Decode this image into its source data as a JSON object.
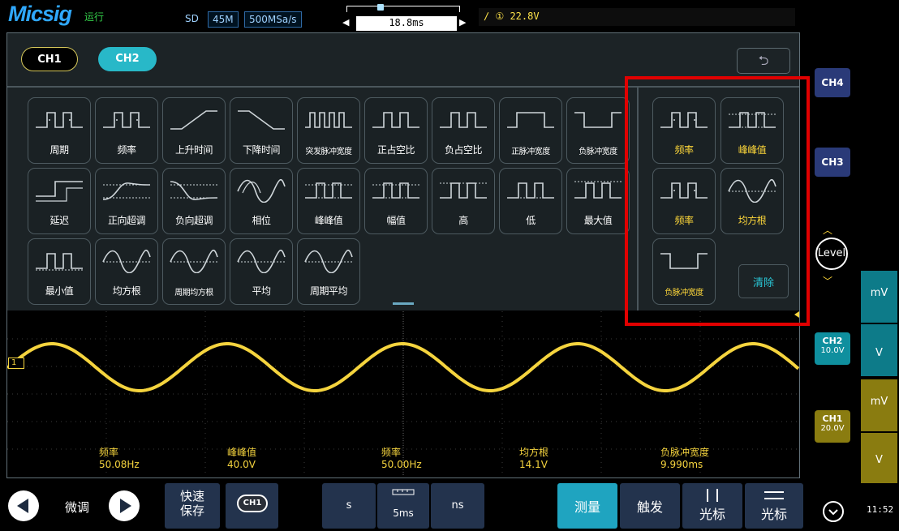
{
  "topbar": {
    "logo": "Micsig",
    "run_state": "运行",
    "sd": "SD",
    "memory": "45M",
    "sample_rate": "500MSa/s",
    "timebase_position": "18.8ms",
    "trigger_info": "① 22.8V"
  },
  "measure_panel": {
    "tabs": [
      {
        "label": "CH1"
      },
      {
        "label": "CH2"
      }
    ],
    "back_icon": "return-arrow-icon",
    "measurements": [
      {
        "label": "周期",
        "icon": "period-icon"
      },
      {
        "label": "频率",
        "icon": "frequency-icon"
      },
      {
        "label": "上升时间",
        "icon": "rise-time-icon"
      },
      {
        "label": "下降时间",
        "icon": "fall-time-icon"
      },
      {
        "label": "突发脉冲宽度",
        "icon": "burst-width-icon"
      },
      {
        "label": "正占空比",
        "icon": "positive-duty-icon"
      },
      {
        "label": "负占空比",
        "icon": "negative-duty-icon"
      },
      {
        "label": "正脉冲宽度",
        "icon": "positive-pulse-width-icon"
      },
      {
        "label": "负脉冲宽度",
        "icon": "negative-pulse-width-icon"
      },
      {
        "label": "延迟",
        "icon": "delay-icon"
      },
      {
        "label": "正向超调",
        "icon": "positive-overshoot-icon"
      },
      {
        "label": "负向超调",
        "icon": "negative-overshoot-icon"
      },
      {
        "label": "相位",
        "icon": "phase-icon"
      },
      {
        "label": "峰峰值",
        "icon": "peak-to-peak-icon"
      },
      {
        "label": "幅值",
        "icon": "amplitude-icon"
      },
      {
        "label": "高",
        "icon": "high-icon"
      },
      {
        "label": "低",
        "icon": "low-icon"
      },
      {
        "label": "最大值",
        "icon": "maximum-icon"
      },
      {
        "label": "最小值",
        "icon": "minimum-icon"
      },
      {
        "label": "均方根",
        "icon": "rms-icon"
      },
      {
        "label": "周期均方根",
        "icon": "cycle-rms-icon"
      },
      {
        "label": "平均",
        "icon": "mean-icon"
      },
      {
        "label": "周期平均",
        "icon": "cycle-mean-icon"
      }
    ],
    "selected": [
      {
        "label": "频率",
        "icon": "frequency-icon"
      },
      {
        "label": "峰峰值",
        "icon": "peak-to-peak-icon"
      },
      {
        "label": "频率",
        "icon": "frequency-icon"
      },
      {
        "label": "均方根",
        "icon": "rms-icon"
      },
      {
        "label": "负脉冲宽度",
        "icon": "negative-pulse-width-icon"
      }
    ],
    "clear_label": "清除"
  },
  "readouts": [
    {
      "label": "频率",
      "value": "50.08Hz"
    },
    {
      "label": "峰峰值",
      "value": "40.0V"
    },
    {
      "label": "频率",
      "value": "50.00Hz"
    },
    {
      "label": "均方根",
      "value": "14.1V"
    },
    {
      "label": "负脉冲宽度",
      "value": "9.990ms"
    }
  ],
  "channel1_marker": "1",
  "right_panel": {
    "ch4": "CH4",
    "ch3": "CH3",
    "level": "Level",
    "ch2": {
      "label": "CH2",
      "scale": "10.0V",
      "unit_mv": "mV",
      "unit_v": "V"
    },
    "ch1": {
      "label": "CH1",
      "scale": "20.0V",
      "unit_mv": "mV",
      "unit_v": "V"
    }
  },
  "bottombar": {
    "fine_label": "微调",
    "quick_save_line1": "快速",
    "quick_save_line2": "保存",
    "ch_select_label": "CH1",
    "timebase_s": "s",
    "timebase_value": "5ms",
    "timebase_ns": "ns",
    "measure": "测量",
    "trigger": "触发",
    "cursor1": "光标",
    "cursor2": "光标",
    "clock": "11:52"
  },
  "colors": {
    "ch1": "#f5d43e",
    "ch2": "#28b8c8",
    "accent": "#1fa4c0",
    "highlight": "#e10000"
  }
}
